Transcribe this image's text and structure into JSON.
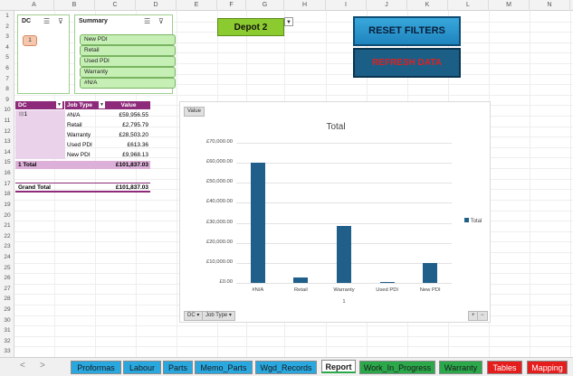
{
  "columns": [
    "A",
    "B",
    "C",
    "D",
    "E",
    "F",
    "G",
    "H",
    "I",
    "J",
    "K",
    "L",
    "M",
    "N",
    "O",
    "P"
  ],
  "rows": [
    "1",
    "2",
    "3",
    "4",
    "5",
    "6",
    "7",
    "8",
    "9",
    "10",
    "11",
    "12",
    "13",
    "14",
    "15",
    "16",
    "17",
    "18",
    "19",
    "20",
    "21",
    "22",
    "23",
    "24",
    "25",
    "26",
    "27",
    "28",
    "29",
    "30",
    "31",
    "32",
    "33"
  ],
  "dc_slicer": {
    "title": "DC",
    "items": [
      "1"
    ]
  },
  "summary_slicer": {
    "title": "Summary",
    "items": [
      "New PDI",
      "Retail",
      "Used PDI",
      "Warranty",
      "#N/A"
    ]
  },
  "buttons": {
    "depot": "Depot 2",
    "reset": "RESET FILTERS",
    "refresh": "REFRESH DATA"
  },
  "pivot": {
    "headers": [
      "DC",
      "Job Type",
      "Value"
    ],
    "dc_value": "1",
    "rows": [
      {
        "job": "#N/A",
        "value": "£59,956.55"
      },
      {
        "job": "Retail",
        "value": "£2,795.79"
      },
      {
        "job": "Warranty",
        "value": "£28,503.20"
      },
      {
        "job": "Used PDI",
        "value": "£613.36"
      },
      {
        "job": "New PDI",
        "value": "£9,968.13"
      }
    ],
    "subtotal_label": "1 Total",
    "subtotal_value": "£101,837.03",
    "grand_label": "Grand Total",
    "grand_value": "£101,837.03"
  },
  "chart_data": {
    "type": "bar",
    "title": "Total",
    "value_chip": "Value",
    "categories": [
      "#N/A",
      "Retail",
      "Warranty",
      "Used PDI",
      "New PDI"
    ],
    "values": [
      59956.55,
      2795.79,
      28503.2,
      613.36,
      9968.13
    ],
    "ylim": [
      0,
      70000
    ],
    "yticks": [
      "£0.00",
      "£10,000.00",
      "£20,000.00",
      "£30,000.00",
      "£40,000.00",
      "£50,000.00",
      "£60,000.00",
      "£70,000.00"
    ],
    "group_label": "1",
    "legend": "Total",
    "legend_position": "right",
    "bar_color": "#1f5f89",
    "field_buttons": [
      "DC ▾",
      "Job Type ▾"
    ],
    "zoom_buttons": [
      "+",
      "−"
    ]
  },
  "tabs": [
    {
      "label": "Proformas",
      "color": "#29a8e0",
      "text": "#1a1a1a"
    },
    {
      "label": "Labour",
      "color": "#29a8e0",
      "text": "#1a1a1a"
    },
    {
      "label": "Parts",
      "color": "#29a8e0",
      "text": "#1a1a1a"
    },
    {
      "label": "Memo_Parts",
      "color": "#29a8e0",
      "text": "#1a1a1a"
    },
    {
      "label": "Wgd_Records",
      "color": "#29a8e0",
      "text": "#1a1a1a"
    },
    {
      "label": "Report",
      "color": "#ffffff",
      "text": "#1a1a1a",
      "active": true
    },
    {
      "label": "Work_In_Progress",
      "color": "#2aa84a",
      "text": "#1a1a1a"
    },
    {
      "label": "Warranty",
      "color": "#2aa84a",
      "text": "#1a1a1a"
    },
    {
      "label": "Tables",
      "color": "#e61d1d",
      "text": "#ffffff"
    },
    {
      "label": "Mapping",
      "color": "#e61d1d",
      "text": "#ffffff"
    }
  ],
  "nav": {
    "prev": "<",
    "next": ">"
  }
}
